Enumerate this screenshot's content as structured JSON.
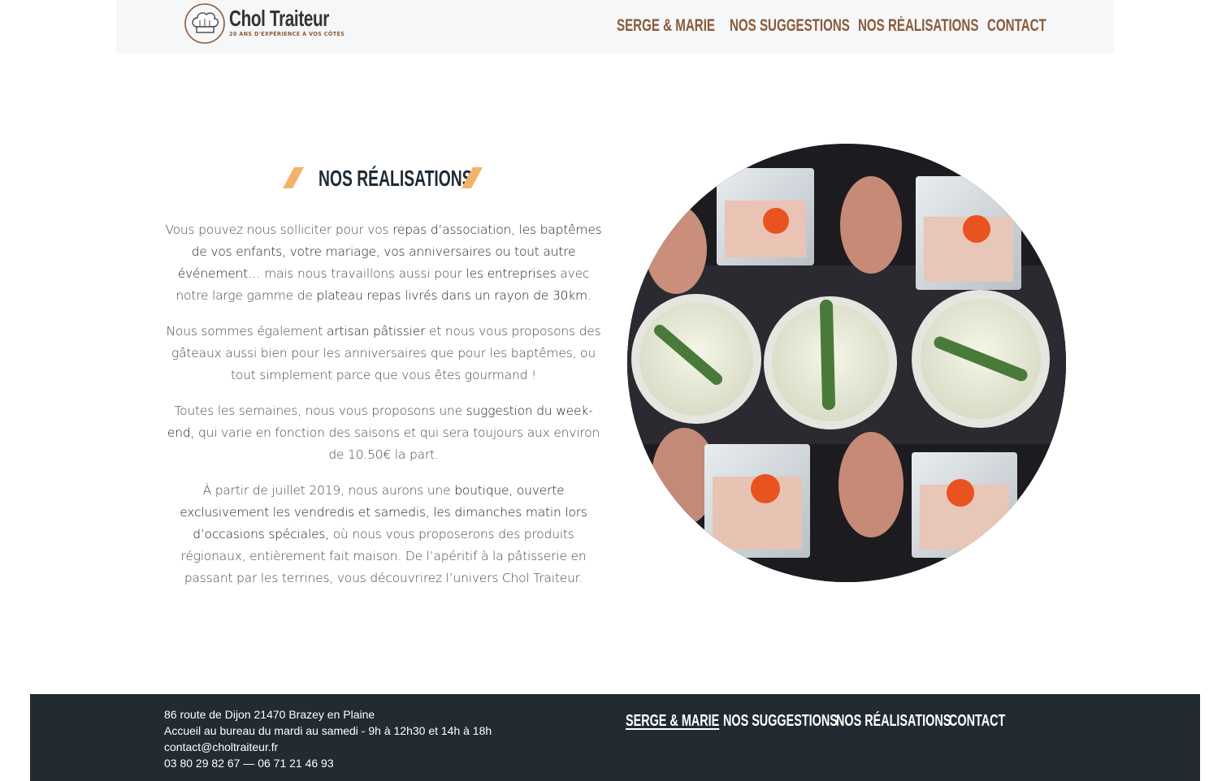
{
  "brand": {
    "name": "Chol Traiteur",
    "tagline": "20 ANS D'EXPÉRIENCE À VOS CÔTÉS"
  },
  "nav": {
    "items": [
      "SERGE & MARIE",
      "NOS SUGGESTIONS",
      "NOS RÉALISATIONS",
      "CONTACT"
    ]
  },
  "section": {
    "title": "NOS RÉALISATIONS",
    "paragraphs": [
      [
        {
          "t": "Vous pouvez nous solliciter pour vos ",
          "h": false
        },
        {
          "t": "repas d’association, les baptêmes de vos enfants, votre mariage, vos anniversaires ou tout autre événement…",
          "h": true
        },
        {
          "t": " mais nous travaillons aussi pour ",
          "h": false
        },
        {
          "t": "les entreprises",
          "h": true
        },
        {
          "t": " avec notre large gamme de ",
          "h": false
        },
        {
          "t": "plateau repas livrés dans un rayon de 30km.",
          "h": true
        }
      ],
      [
        {
          "t": "Nous sommes également ",
          "h": false
        },
        {
          "t": "artisan pâtissier",
          "h": true
        },
        {
          "t": " et nous vous proposons des gâteaux aussi bien pour les anniversaires que pour les baptêmes, ou tout simplement parce que vous êtes gourmand !",
          "h": false
        }
      ],
      [
        {
          "t": "Toutes les semaines, nous vous proposons une ",
          "h": false
        },
        {
          "t": "suggestion du week-end,",
          "h": true
        },
        {
          "t": " qui varie en fonction des saisons et qui sera toujours aux environ de 10.50€ la part.",
          "h": false
        }
      ],
      [
        {
          "t": "À partir de juillet 2019, nous aurons une ",
          "h": false
        },
        {
          "t": "boutique, ouverte exclusivement les vendredis et samedis, les dimanches matin lors d’occasions spéciales,",
          "h": true
        },
        {
          "t": " où nous vous proposerons des produits régionaux, entièrement fait maison. De l’apéritif à la pâtisserie en passant par les terrines, vous découvrirez l’univers Chol Traiteur.",
          "h": false
        }
      ]
    ]
  },
  "footer": {
    "address": "86 route de Dijon 21470 Brazey en Plaine",
    "hours": "Accueil au bureau du mardi au samedi - 9h à 12h30 et 14h à 18h",
    "email": "contact@choltraiteur.fr",
    "phones": "03 80 29 82 67 — 06 71 21 46 93"
  },
  "colors": {
    "accent_brown": "#8a5a3c",
    "accent_orange": "#f5b26b",
    "footer_bg": "#212b31",
    "header_bg": "#f6f7f8"
  },
  "icons": [
    "chef-hat-logo",
    "title-slash-icon"
  ]
}
